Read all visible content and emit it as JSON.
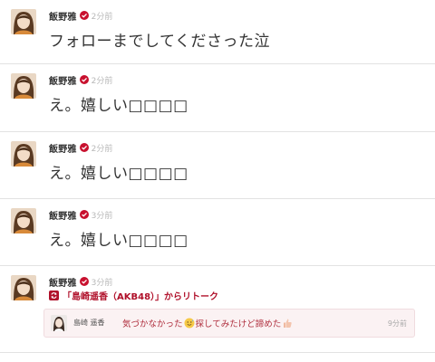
{
  "posts": [
    {
      "author": "飯野雅",
      "time": "2分前",
      "text": "フォローまでしてくださった泣"
    },
    {
      "author": "飯野雅",
      "time": "2分前",
      "text": "え。嬉しい□□□□"
    },
    {
      "author": "飯野雅",
      "time": "2分前",
      "text": "え。嬉しい□□□□"
    },
    {
      "author": "飯野雅",
      "time": "3分前",
      "text": "え。嬉しい□□□□"
    },
    {
      "author": "飯野雅",
      "time": "3分前",
      "retalk_label": "「島崎遥香（AKB48）」からリトーク",
      "quote": {
        "author": "島崎 遥香",
        "text_before": "気づかなかった",
        "emoji1": "sweat-smile-emoji",
        "text_after": "探してみたけど諦めた",
        "emoji2": "thumbs-up-emoji",
        "time": "9分前"
      }
    }
  ],
  "colors": {
    "accent": "#b0102a",
    "verified": "#c8102e",
    "divider": "#e2e2e2",
    "quote_bg": "#fbf2f3"
  },
  "icons": {
    "verified": "verified-check-icon",
    "retalk": "retalk-icon"
  }
}
